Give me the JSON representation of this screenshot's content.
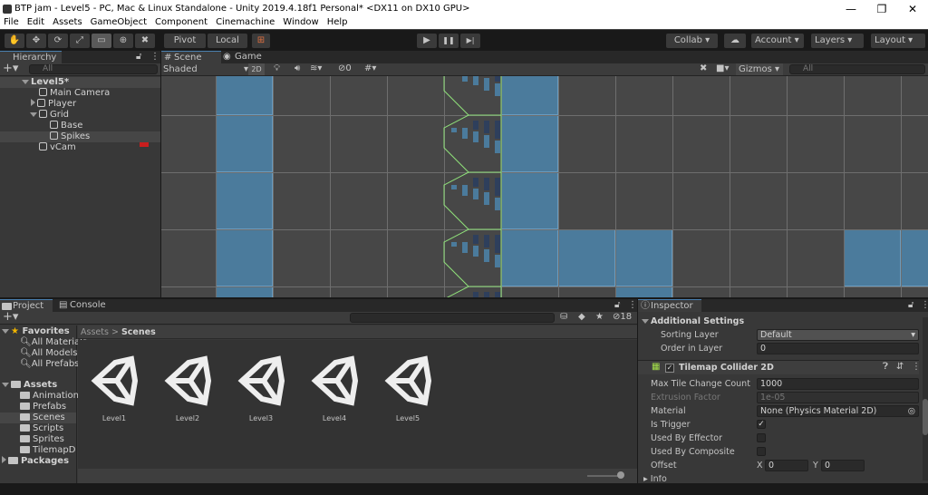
{
  "window": {
    "title": "BTP jam - Level5 - PC, Mac & Linux Standalone - Unity 2019.4.18f1 Personal* <DX11 on DX10 GPU>",
    "minimize": "—",
    "maximize": "❐",
    "close": "✕"
  },
  "menu": [
    "File",
    "Edit",
    "Assets",
    "GameObject",
    "Component",
    "Cinemachine",
    "Window",
    "Help"
  ],
  "toolbar": {
    "tools": [
      "✋",
      "✥",
      "⟳",
      "⤢",
      "▭",
      "⊕",
      "✖"
    ],
    "pivot": "Pivot",
    "local": "Local",
    "play": "▶",
    "pause": "❚❚",
    "step": "▶|",
    "collab": "Collab ▾",
    "account": "Account",
    "layers": "Layers",
    "layout": "Layout"
  },
  "hierarchy": {
    "tab": "Hierarchy",
    "search_placeholder": "All",
    "scene": "Level5*",
    "items": [
      {
        "label": "Main Camera",
        "depth": 1
      },
      {
        "label": "Player",
        "depth": 1,
        "collapsed": true
      },
      {
        "label": "Grid",
        "depth": 1,
        "expanded": true
      },
      {
        "label": "Base",
        "depth": 2
      },
      {
        "label": "Spikes",
        "depth": 2,
        "selected": true
      },
      {
        "label": "vCam",
        "depth": 1
      }
    ]
  },
  "scene": {
    "tabs": [
      "Scene",
      "Game"
    ],
    "active_tab": "Scene",
    "shading": "Shaded",
    "mode_2d": "2D",
    "hidden_count": "0",
    "gizmos": "Gizmos",
    "search_placeholder": "All",
    "colors": {
      "tile": "#4b7b9c",
      "collider": "#8fe07a",
      "background": "#474747"
    }
  },
  "project": {
    "tabs": [
      "Project",
      "Console"
    ],
    "favorites_label": "Favorites",
    "favorites": [
      "All Materials",
      "All Models",
      "All Prefabs"
    ],
    "assets_label": "Assets",
    "folders": [
      "Animations",
      "Prefabs",
      "Scenes",
      "Scripts",
      "Sprites",
      "TilemapDat"
    ],
    "selected_folder": "Scenes",
    "packages_label": "Packages",
    "breadcrumb": [
      "Assets",
      "Scenes"
    ],
    "breadcrumb_sep": ">",
    "hidden_count": "18",
    "files": [
      "Level1",
      "Level2",
      "Level3",
      "Level4",
      "Level5"
    ]
  },
  "inspector": {
    "tab": "Inspector",
    "additional_settings": "Additional Settings",
    "sorting_layer_label": "Sorting Layer",
    "sorting_layer": "Default",
    "order_label": "Order in Layer",
    "order": "0",
    "component": "Tilemap Collider 2D",
    "component_enabled": true,
    "props": {
      "max_tile_label": "Max Tile Change Count",
      "max_tile": "1000",
      "extrusion_label": "Extrusion Factor",
      "extrusion": "1e-05",
      "material_label": "Material",
      "material": "None (Physics Material 2D)",
      "trigger_label": "Is Trigger",
      "is_trigger": true,
      "effector_label": "Used By Effector",
      "used_by_effector": false,
      "composite_label": "Used By Composite",
      "used_by_composite": false,
      "offset_label": "Offset",
      "x_label": "X",
      "offset_x": "0",
      "y_label": "Y",
      "offset_y": "0",
      "info_label": "Info"
    }
  }
}
